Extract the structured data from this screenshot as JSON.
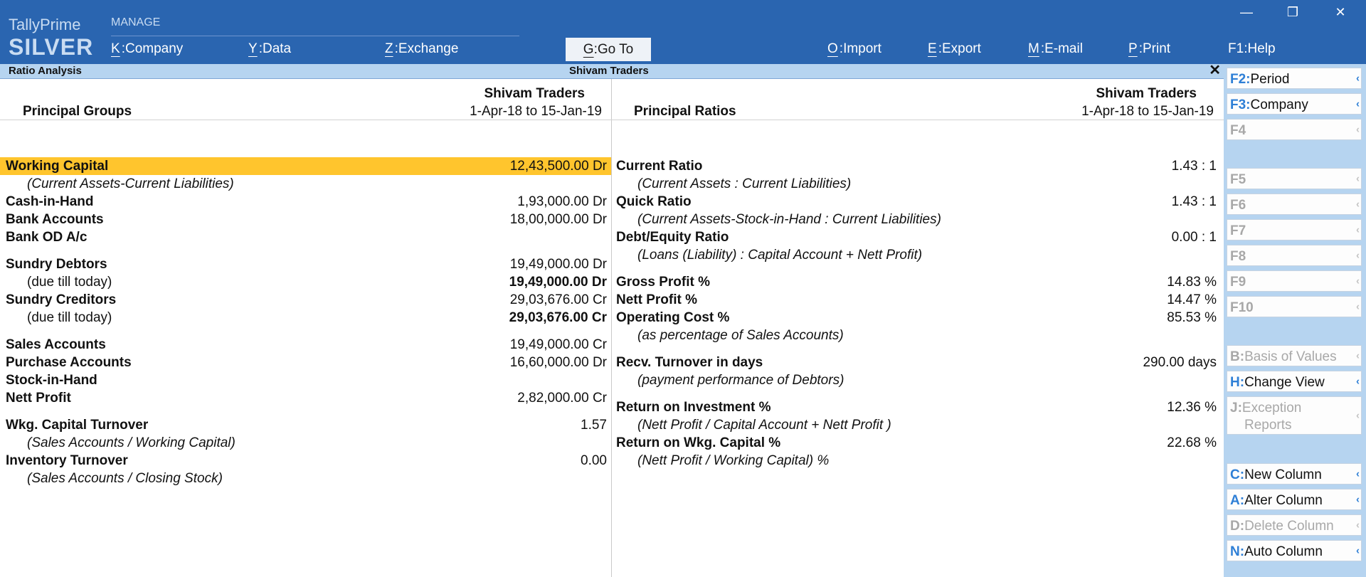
{
  "app": {
    "name": "TallyPrime",
    "edition": "SILVER"
  },
  "menu": {
    "section_label": "MANAGE",
    "company": {
      "key": "K",
      "label": "Company"
    },
    "data": {
      "key": "Y",
      "label": "Data"
    },
    "exchange": {
      "key": "Z",
      "label": "Exchange"
    },
    "goto": {
      "key": "G",
      "label": "Go To"
    },
    "import": {
      "key": "O",
      "label": "Import"
    },
    "export": {
      "key": "E",
      "label": "Export"
    },
    "email": {
      "key": "M",
      "label": "E-mail"
    },
    "print": {
      "key": "P",
      "label": "Print"
    },
    "help": {
      "key": "F1",
      "label": "Help"
    }
  },
  "window": {
    "minimize": "—",
    "restore": "❐",
    "close": "✕"
  },
  "titlebar": {
    "report": "Ratio Analysis",
    "company": "Shivam Traders",
    "close": "✕"
  },
  "left": {
    "title": "Principal Groups",
    "company": "Shivam Traders",
    "period": "1-Apr-18 to 15-Jan-19",
    "rows": [
      {
        "label": "Working Capital",
        "value": "12,43,500.00 Dr"
      },
      {
        "label": "(Current Assets-Current Liabilities)",
        "value": ""
      },
      {
        "label": "Cash-in-Hand",
        "value": "1,93,000.00 Dr"
      },
      {
        "label": "Bank Accounts",
        "value": "18,00,000.00 Dr"
      },
      {
        "label": "Bank OD A/c",
        "value": ""
      },
      {
        "label": "Sundry Debtors",
        "value": "19,49,000.00 Dr"
      },
      {
        "label": "(due till today)",
        "value": "19,49,000.00 Dr"
      },
      {
        "label": "Sundry Creditors",
        "value": "29,03,676.00 Cr"
      },
      {
        "label": "(due till today)",
        "value": "29,03,676.00 Cr"
      },
      {
        "label": "Sales Accounts",
        "value": "19,49,000.00 Cr"
      },
      {
        "label": "Purchase Accounts",
        "value": "16,60,000.00 Dr"
      },
      {
        "label": "Stock-in-Hand",
        "value": ""
      },
      {
        "label": "Nett Profit",
        "value": "2,82,000.00 Cr"
      },
      {
        "label": "Wkg. Capital Turnover",
        "value": "1.57"
      },
      {
        "label": "(Sales Accounts / Working Capital)",
        "value": ""
      },
      {
        "label": "Inventory Turnover",
        "value": "0.00"
      },
      {
        "label": "(Sales Accounts / Closing Stock)",
        "value": ""
      }
    ]
  },
  "right": {
    "title": "Principal Ratios",
    "company": "Shivam Traders",
    "period": "1-Apr-18 to 15-Jan-19",
    "rows": [
      {
        "label": "Current Ratio",
        "value": "1.43 : 1"
      },
      {
        "label": "(Current Assets : Current Liabilities)",
        "value": ""
      },
      {
        "label": "Quick Ratio",
        "value": "1.43 : 1"
      },
      {
        "label": "(Current Assets-Stock-in-Hand : Current Liabilities)",
        "value": ""
      },
      {
        "label": "Debt/Equity Ratio",
        "value": "0.00 : 1"
      },
      {
        "label": "(Loans (Liability) : Capital Account + Nett Profit)",
        "value": ""
      },
      {
        "label": "Gross Profit %",
        "value": "14.83 %"
      },
      {
        "label": "Nett Profit %",
        "value": "14.47 %"
      },
      {
        "label": "Operating Cost %",
        "value": "85.53 %"
      },
      {
        "label": "(as percentage of Sales Accounts)",
        "value": ""
      },
      {
        "label": "Recv. Turnover in days",
        "value": "290.00 days"
      },
      {
        "label": "(payment performance of Debtors)",
        "value": ""
      },
      {
        "label": "Return on Investment %",
        "value": "12.36 %"
      },
      {
        "label": "(Nett Profit / Capital Account + Nett Profit )",
        "value": ""
      },
      {
        "label": "Return on Wkg. Capital %",
        "value": "22.68 %"
      },
      {
        "label": "(Nett Profit / Working Capital) %",
        "value": ""
      }
    ]
  },
  "panel": {
    "f2": {
      "key": "F2:",
      "label": "Period"
    },
    "f3": {
      "key": "F3:",
      "label": "Company"
    },
    "f4": {
      "key": "F4",
      "label": ""
    },
    "f5": {
      "key": "F5",
      "label": ""
    },
    "f6": {
      "key": "F6",
      "label": ""
    },
    "f7": {
      "key": "F7",
      "label": ""
    },
    "f8": {
      "key": "F8",
      "label": ""
    },
    "f9": {
      "key": "F9",
      "label": ""
    },
    "f10": {
      "key": "F10",
      "label": ""
    },
    "b": {
      "key": "B:",
      "label": "Basis of Values"
    },
    "h": {
      "key": "H:",
      "label": "Change View"
    },
    "j": {
      "key": "J:",
      "label": "Exception",
      "label2": "Reports"
    },
    "c": {
      "key": "C:",
      "label": "New Column"
    },
    "a": {
      "key": "A:",
      "label": "Alter Column"
    },
    "d": {
      "key": "D:",
      "label": "Delete Column"
    },
    "n": {
      "key": "N:",
      "label": "Auto Column"
    },
    "arrow": "‹"
  }
}
